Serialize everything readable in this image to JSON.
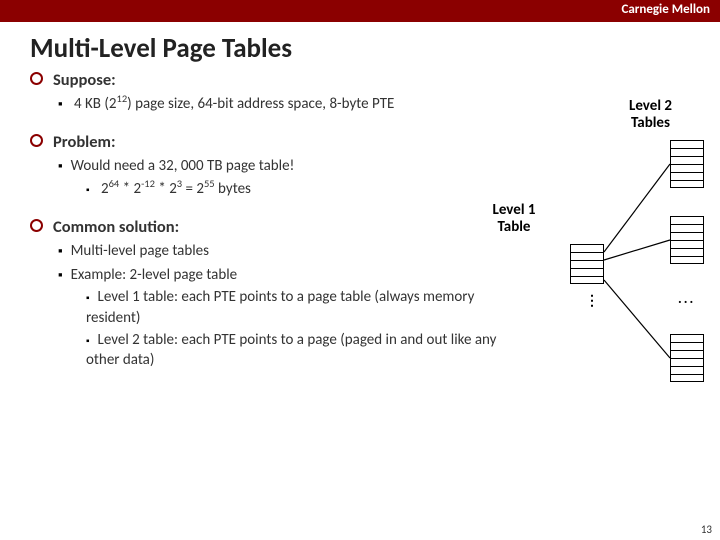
{
  "header": {
    "brand": "Carnegie Mellon"
  },
  "title": "Multi-Level Page Tables",
  "labels": {
    "level2_line1": "Level 2",
    "level2_line2": "Tables",
    "level1_line1": "Level 1",
    "level1_line2": "Table"
  },
  "sections": {
    "suppose": {
      "head": "Suppose:",
      "item1_pre": "4 KB (2",
      "item1_sup": "12",
      "item1_post": ") page size, 64-bit address space, 8-byte PTE"
    },
    "problem": {
      "head": "Problem:",
      "item1": "Would need a 32, 000 TB page table!",
      "item2_a": "2",
      "item2_a_sup": "64",
      "item2_b": " * 2",
      "item2_b_sup": "-12",
      "item2_c": " * 2",
      "item2_c_sup": "3",
      "item2_d": " = 2",
      "item2_d_sup": "55",
      "item2_e": " bytes"
    },
    "solution": {
      "head": "Common solution:",
      "item1": "Multi-level page tables",
      "item2": "Example: 2-level page table",
      "item2a": "Level 1 table: each PTE points to a page table (always memory resident)",
      "item2b": "Level 2 table: each PTE points to a page (paged in and out like any other data)"
    }
  },
  "page_number": "13",
  "dots": {
    "v": "⋮",
    "h": "..."
  }
}
